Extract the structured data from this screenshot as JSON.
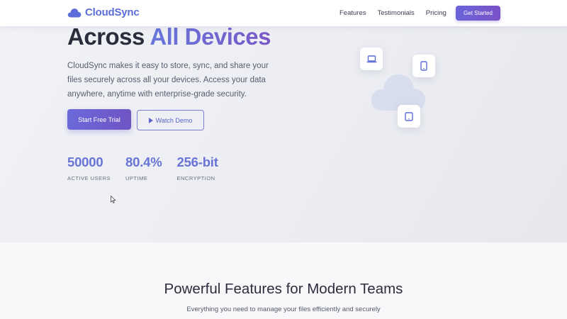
{
  "nav": {
    "brand": "CloudSync",
    "links": [
      "Features",
      "Testimonials",
      "Pricing"
    ],
    "cta_label": "Get Started"
  },
  "hero": {
    "title_plain": "Across ",
    "title_accent": "All Devices",
    "description": "CloudSync makes it easy to store, sync, and share your files securely across all your devices. Access your data anywhere, anytime with enterprise-grade security.",
    "primary_button": "Start Free Trial",
    "secondary_button": "Watch Demo",
    "stats": [
      {
        "value": "50000",
        "label": "ACTIVE USERS"
      },
      {
        "value": "80.4%",
        "label": "UPTIME"
      },
      {
        "value": "256-bit",
        "label": "ENCRYPTION"
      }
    ],
    "illustration_icons": [
      "cloud-icon",
      "laptop-icon",
      "tablet-icon",
      "tablet-icon"
    ]
  },
  "features": {
    "title": "Powerful Features for Modern Teams",
    "subtitle": "Everything you need to manage your files efficiently and securely"
  },
  "colors": {
    "brand": "#5b6dd8",
    "accent_gradient_start": "#6b6adb",
    "accent_gradient_end": "#7a52c8",
    "stat_value": "#6874d6"
  }
}
